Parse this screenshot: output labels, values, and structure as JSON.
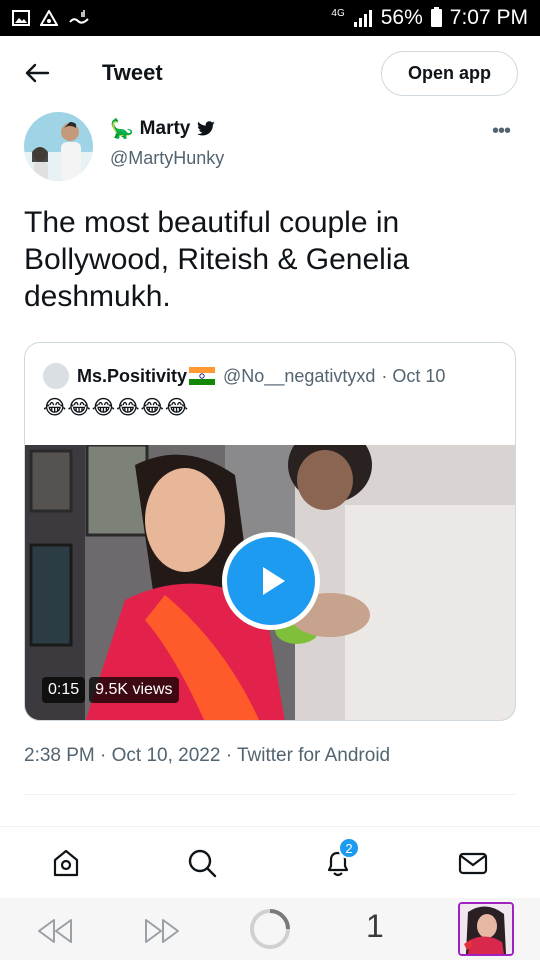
{
  "status_bar": {
    "network": "4G",
    "battery": "56%",
    "time": "7:07 PM"
  },
  "header": {
    "title": "Tweet",
    "open_app_label": "Open app"
  },
  "tweet": {
    "author": {
      "emoji": "🦕",
      "name": "Marty",
      "handle": "@MartyHunky"
    },
    "text": "The most beautiful couple in Bollywood, Riteish & Genelia deshmukh.",
    "quoted": {
      "name": "Ms.Positivity",
      "handle": "@No__negativtyxd",
      "date": "· Oct 10",
      "text": "😂😂😂😂😂😂",
      "video": {
        "duration": "0:15",
        "views": "9.5K views"
      }
    },
    "meta": "2:38 PM · Oct 10, 2022 · Twitter for Android"
  },
  "bottom_nav": {
    "notification_count": "2"
  },
  "browser_bar": {
    "tab_count": "1"
  },
  "colors": {
    "accent": "#1d9bf0",
    "text_primary": "#0f1419",
    "text_secondary": "#536471",
    "border": "#cfd9de"
  }
}
